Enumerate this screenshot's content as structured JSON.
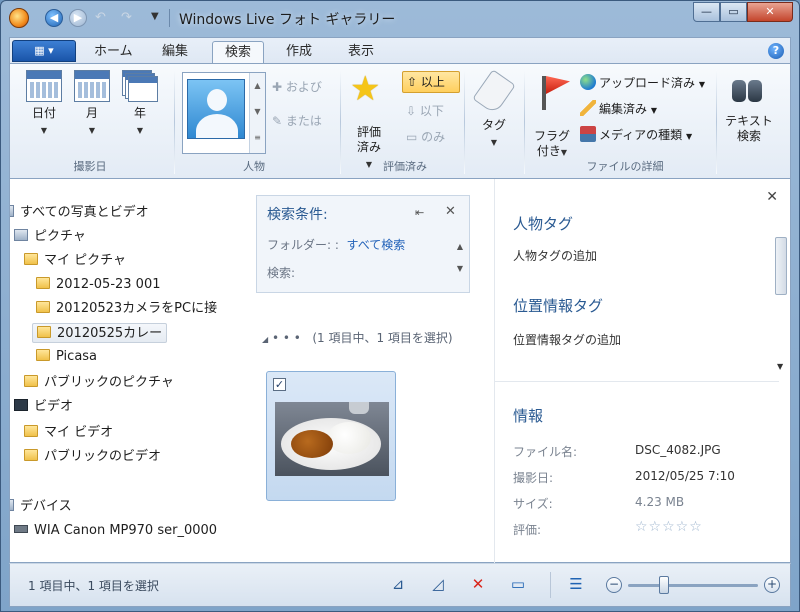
{
  "window": {
    "title": "Windows Live フォト ギャラリー",
    "minimize": "—",
    "maximize": "▭",
    "close": "✕"
  },
  "ribbon": {
    "file_tab": "▦ ▾",
    "tabs": [
      "ホーム",
      "編集",
      "検索",
      "作成",
      "表示"
    ],
    "active_tab": "検索",
    "help": "?",
    "date_group": {
      "label": "撮影日",
      "buttons": [
        "日付",
        "月",
        "年"
      ]
    },
    "people_group": {
      "label": "人物",
      "and": "および",
      "or": "または"
    },
    "rating_group": {
      "label": "評価済み",
      "rated": "評価\n済み",
      "above": "以上",
      "below": "以下",
      "only": "のみ"
    },
    "tag": "タグ",
    "file_group": {
      "label": "ファイルの詳細",
      "flagged": "フラグ\n付き",
      "uploaded": "アップロード済み",
      "edited": "編集済み",
      "media_type": "メディアの種類"
    },
    "text_search": "テキスト\n検索"
  },
  "tree": {
    "items": [
      "すべての写真とビデオ",
      "ピクチャ",
      "マイ ピクチャ",
      "2012-05-23 001",
      "20120523カメラをPCに接",
      "20120525カレー",
      "Picasa",
      "パブリックのピクチャ",
      "ビデオ",
      "マイ ビデオ",
      "パブリックのビデオ",
      "デバイス",
      "WIA Canon MP970 ser_0000"
    ],
    "selected": "20120525カレー"
  },
  "search_panel": {
    "title": "検索条件:",
    "folder_label": "フォルダー:",
    "folder_value": "すべて検索",
    "search_label": "検索:"
  },
  "gallery": {
    "group_dots": "• • •",
    "group_info": "(1 項目中、1 項目を選択)",
    "photo_checked": "✓"
  },
  "details": {
    "people_tags_title": "人物タグ",
    "people_tags_add": "人物タグの追加",
    "geo_tags_title": "位置情報タグ",
    "geo_tags_add": "位置情報タグの追加",
    "info_title": "情報",
    "info": [
      {
        "label": "ファイル名:",
        "value": "DSC_4082.JPG"
      },
      {
        "label": "撮影日:",
        "value": "2012/05/25  7:10"
      },
      {
        "label": "サイズ:",
        "value": "4.23 MB"
      },
      {
        "label": "評価:",
        "value": "☆☆☆☆☆"
      }
    ]
  },
  "status": {
    "text": "1 項目中、1 項目を選択",
    "zoom_level": 0.28
  },
  "colors": {
    "accent": "#2a5a92",
    "selection": "#c4d9f0",
    "star": "#f5c518",
    "delete": "#d9261c"
  }
}
